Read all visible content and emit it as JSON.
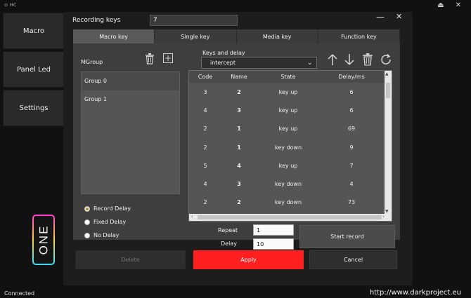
{
  "app": {
    "logo_text": "⊙ HC"
  },
  "sidebar": {
    "items": [
      {
        "label": "Macro"
      },
      {
        "label": "Panel Led"
      },
      {
        "label": "Settings"
      }
    ]
  },
  "brand_logo": "ONE",
  "status_text": "Connected",
  "url": "http://www.darkproject.eu",
  "dialog": {
    "title": "Recording keys",
    "recording_value": "7",
    "tabs": [
      {
        "label": "Macro key",
        "active": true
      },
      {
        "label": "Single key",
        "active": false
      },
      {
        "label": "Media key",
        "active": false
      },
      {
        "label": "Function key",
        "active": false
      }
    ],
    "mgroup": {
      "label": "MGroup",
      "groups": [
        {
          "label": "Group 0",
          "selected": true
        },
        {
          "label": "Group 1",
          "selected": false
        }
      ]
    },
    "delay_options": [
      {
        "label": "Record Delay",
        "checked": true
      },
      {
        "label": "Fixed Delay",
        "checked": false
      },
      {
        "label": "No Delay",
        "checked": false
      }
    ],
    "keys_and_delay": {
      "label": "Keys and delay",
      "mode": "intercept"
    },
    "table": {
      "headers": [
        "Code",
        "Name",
        "State",
        "Delay/ms"
      ],
      "rows": [
        [
          "3",
          "2",
          "key up",
          "6"
        ],
        [
          "4",
          "3",
          "key up",
          "6"
        ],
        [
          "2",
          "1",
          "key up",
          "69"
        ],
        [
          "2",
          "1",
          "key down",
          "9"
        ],
        [
          "5",
          "4",
          "key up",
          "7"
        ],
        [
          "4",
          "3",
          "key down",
          "4"
        ],
        [
          "2",
          "2",
          "key down",
          "73"
        ]
      ]
    },
    "repeat": {
      "label": "Repeat",
      "value": "1"
    },
    "delay": {
      "label": "Delay",
      "value": "10"
    },
    "start_record_label": "Start record",
    "footer": {
      "delete_label": "Delete",
      "apply_label": "Apply",
      "cancel_label": "Cancel"
    }
  },
  "colors": {
    "accent_red": "#ff1f1f",
    "radio_checked": "#b58a1e"
  }
}
